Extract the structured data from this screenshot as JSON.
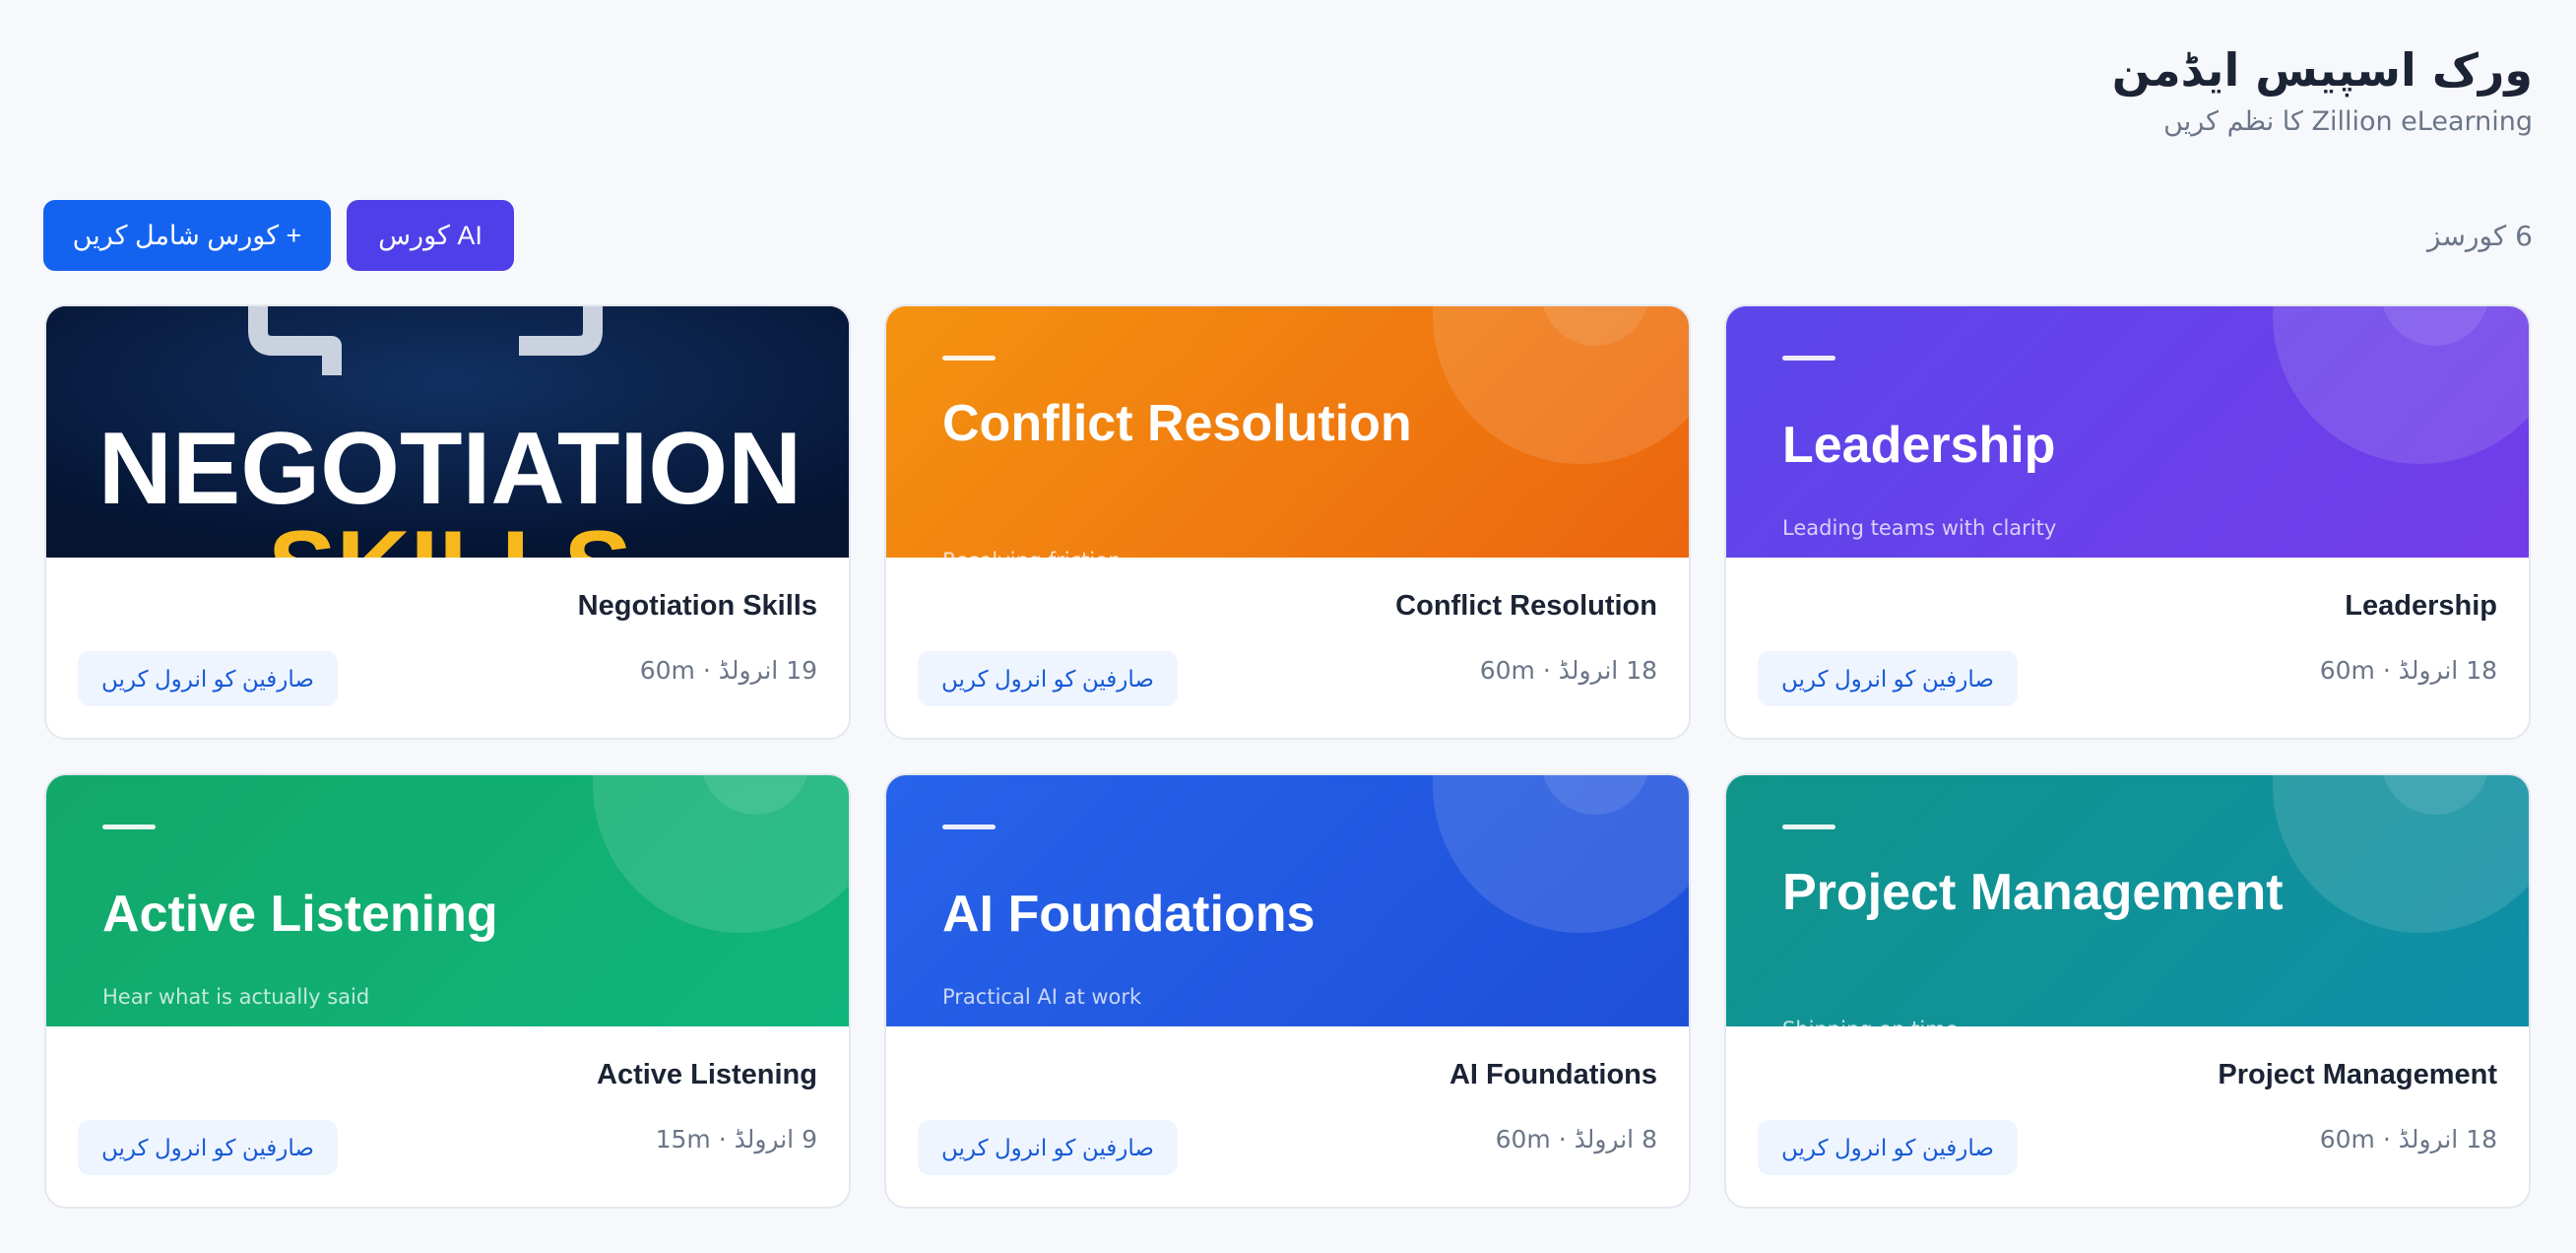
{
  "header": {
    "title": "ورک اسپیس ایڈمن",
    "subtitle": "Zillion eLearning کا نظم کریں"
  },
  "toolbar": {
    "add_course_label": "+ کورس شامل کریں",
    "ai_course_label": "AI کورس",
    "course_count": "6 کورسز"
  },
  "courses": [
    {
      "name": "Negotiation Skills",
      "banner_text": "NEGOTIATION",
      "banner_text_2": "SKILLS",
      "meta": "19 انرولڈ · 60m",
      "enroll_label": "صارفین کو انرول کریں"
    },
    {
      "name": "Conflict Resolution",
      "banner_title": "Conflict Resolution",
      "tagline": "Resolving friction",
      "meta": "18 انرولڈ · 60m",
      "enroll_label": "صارفین کو انرول کریں"
    },
    {
      "name": "Leadership",
      "banner_title": "Leadership",
      "tagline": "Leading teams with clarity",
      "meta": "18 انرولڈ · 60m",
      "enroll_label": "صارفین کو انرول کریں"
    },
    {
      "name": "Active Listening",
      "banner_title": "Active Listening",
      "tagline": "Hear what is actually said",
      "meta": "9 انرولڈ · 15m",
      "enroll_label": "صارفین کو انرول کریں"
    },
    {
      "name": "AI Foundations",
      "banner_title": "AI Foundations",
      "tagline": "Practical AI at work",
      "meta": "8 انرولڈ · 60m",
      "enroll_label": "صارفین کو انرول کریں"
    },
    {
      "name": "Project Management",
      "banner_title": "Project Management",
      "tagline": "Shipping on time",
      "meta": "18 انرولڈ · 60m",
      "enroll_label": "صارفین کو انرول کریں"
    }
  ],
  "colors": {
    "add_button": "#1463f0",
    "ai_button": "#4f3fe8",
    "enroll_text": "#1559d6",
    "enroll_bg": "#eff5ff",
    "banner_orange": "#f18a10",
    "banner_purple": "#6542ea",
    "banner_green": "#11ae73",
    "banner_blue": "#2459e2",
    "banner_teal": "#10929a",
    "banner_navy": "#061a3d"
  }
}
